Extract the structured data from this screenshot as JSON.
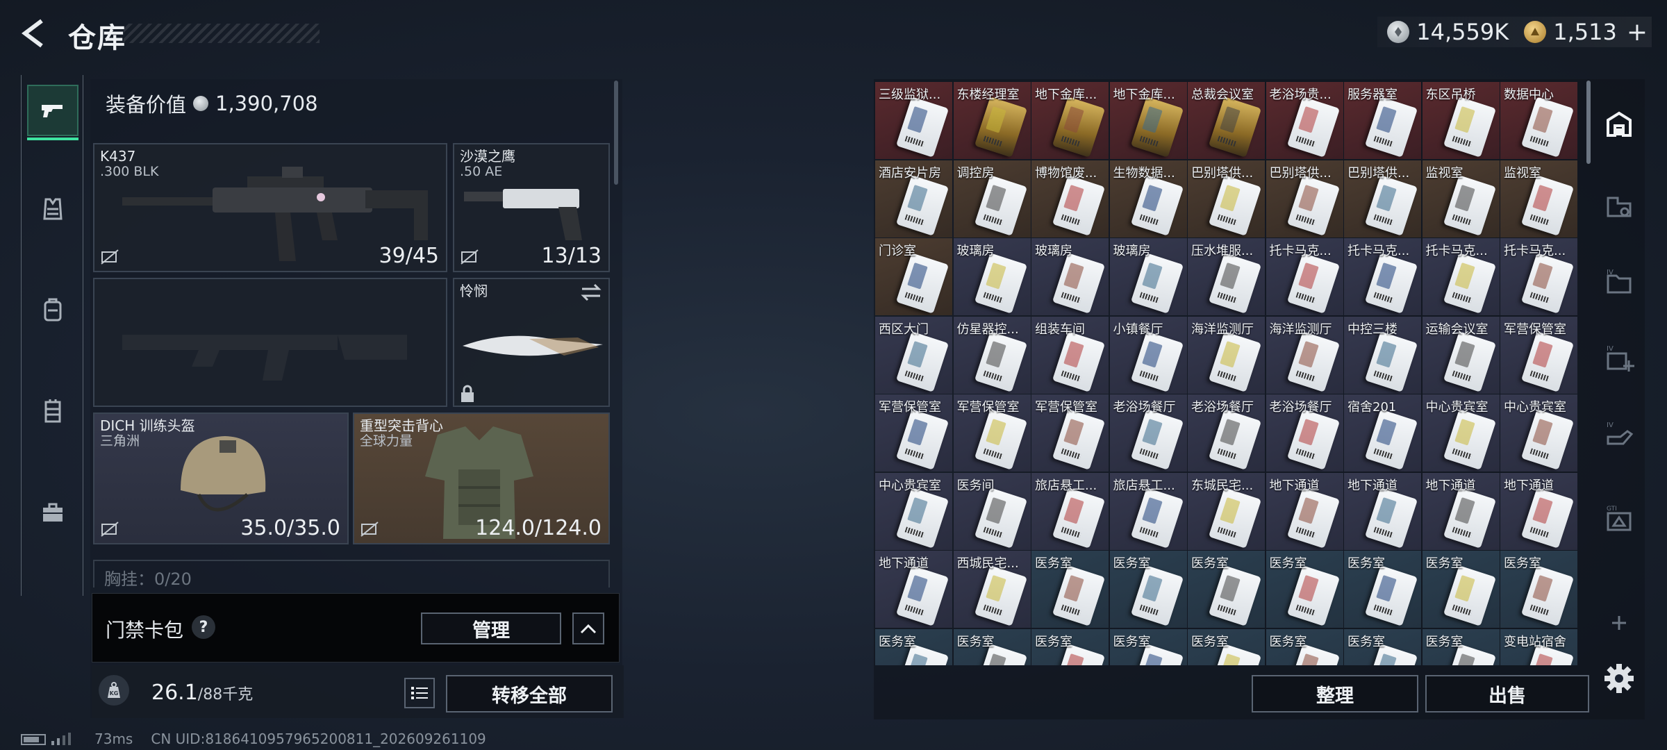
{
  "header": {
    "title": "仓库",
    "currency_silver": "14,559K",
    "currency_gold": "1,513",
    "plus": "+"
  },
  "rail": [
    "pistol-icon",
    "vest-icon",
    "backpack-icon",
    "rig-icon",
    "toolbox-icon"
  ],
  "equipment": {
    "value_label": "装备价值",
    "value": "1,390,708",
    "primary": {
      "name": "K437",
      "sub": ".300 BLK",
      "ammo": "39/45"
    },
    "sidearm": {
      "name": "沙漠之鹰",
      "sub": ".50 AE",
      "ammo": "13/13"
    },
    "melee": {
      "name": "怜悯"
    },
    "helmet": {
      "name": "DICH 训练头盔",
      "sub": "三角洲",
      "durability": "35.0/35.0"
    },
    "armor": {
      "name": "重型突击背心",
      "sub": "全球力量",
      "durability": "124.0/124.0"
    },
    "chest_rig": "胸挂：0/20"
  },
  "keycard": {
    "label": "门禁卡包",
    "help": "?",
    "manage": "管理"
  },
  "weight": {
    "current": "26.1",
    "max": "/88千克",
    "transfer_all": "转移全部",
    "kg_icon": "KG"
  },
  "footer": {
    "ping": "73ms",
    "uid": "CN UID:8186410957965200811_202609261109"
  },
  "storage": {
    "rows": [
      {
        "color": "red",
        "cells": [
          "三级监狱...",
          "东楼经理室",
          "地下金库...",
          "地下金库...",
          "总裁会议室",
          "老浴场贵...",
          "服务器室",
          "东区吊桥",
          "数据中心"
        ],
        "cards": [
          "white",
          "gold",
          "gold",
          "gold",
          "gold",
          "white",
          "white",
          "white",
          "white"
        ]
      },
      {
        "color": "brown",
        "cells": [
          "酒店安片房",
          "调控房",
          "博物馆废...",
          "生物数据...",
          "巴别塔供...",
          "巴别塔供...",
          "巴别塔供...",
          "监视室",
          "监视室"
        ],
        "cards": [
          "white",
          "white",
          "white",
          "white",
          "white",
          "white",
          "white",
          "white",
          "white"
        ]
      },
      {
        "color": "mixed3",
        "cells": [
          "门诊室",
          "玻璃房",
          "玻璃房",
          "玻璃房",
          "压水堆服...",
          "托卡马克...",
          "托卡马克...",
          "托卡马克...",
          "托卡马克..."
        ],
        "cards": [
          "white",
          "white",
          "white",
          "white",
          "white",
          "white",
          "white",
          "white",
          "white"
        ]
      },
      {
        "color": "purple",
        "cells": [
          "西区大门",
          "仿星器控...",
          "组装车间",
          "小镇餐厅",
          "海洋监测厅",
          "海洋监测厅",
          "中控三楼",
          "运输会议室",
          "军营保管室"
        ],
        "cards": [
          "white",
          "white",
          "white",
          "white",
          "white",
          "white",
          "white",
          "white",
          "white"
        ]
      },
      {
        "color": "purple",
        "cells": [
          "军营保管室",
          "军营保管室",
          "军营保管室",
          "老浴场餐厅",
          "老浴场餐厅",
          "老浴场餐厅",
          "宿舍201",
          "中心贵宾室",
          "中心贵宾室"
        ],
        "cards": [
          "white",
          "white",
          "white",
          "white",
          "white",
          "white",
          "white",
          "white",
          "white"
        ]
      },
      {
        "color": "purple",
        "cells": [
          "中心贵宾室",
          "医务间",
          "旅店悬工...",
          "旅店悬工...",
          "东城民宅...",
          "地下通道",
          "地下通道",
          "地下通道",
          "地下通道"
        ],
        "cards": [
          "white",
          "white",
          "white",
          "white",
          "white",
          "white",
          "white",
          "white",
          "white"
        ]
      },
      {
        "color": "mixed7",
        "cells": [
          "地下通道",
          "西城民宅...",
          "医务室",
          "医务室",
          "医务室",
          "医务室",
          "医务室",
          "医务室",
          "医务室"
        ],
        "cards": [
          "white",
          "white",
          "white",
          "white",
          "white",
          "white",
          "white",
          "white",
          "white"
        ]
      },
      {
        "color": "blue",
        "cells": [
          "医务室",
          "医务室",
          "医务室",
          "医务室",
          "医务室",
          "医务室",
          "医务室",
          "医务室",
          "变电站宿舍"
        ],
        "cards": [
          "white",
          "white",
          "white",
          "white",
          "white",
          "white",
          "white",
          "white",
          "white"
        ]
      }
    ],
    "sort": "整理",
    "sell": "出售"
  },
  "right_rail": [
    "home-icon",
    "vest-pocket-icon",
    "folder-iv-icon",
    "add-iv-icon",
    "hand-iv-icon",
    "gti-icon",
    "add-icon"
  ],
  "colors": {
    "accent": "#3ee3a0",
    "red": "#5a2a2e",
    "brown": "#4d3d31",
    "purple": "#36394f",
    "blue": "#2b3f50"
  }
}
